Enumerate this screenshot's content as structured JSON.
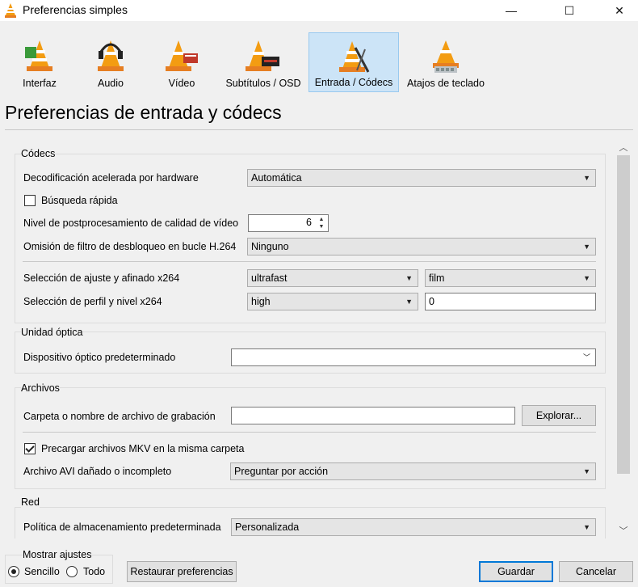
{
  "window": {
    "title": "Preferencias simples",
    "minimize": "—",
    "maximize": "☐",
    "close": "✕"
  },
  "categories": [
    {
      "label": "Interfaz",
      "icon": "cone-interface-icon"
    },
    {
      "label": "Audio",
      "icon": "cone-headphones-icon"
    },
    {
      "label": "Vídeo",
      "icon": "cone-video-icon"
    },
    {
      "label": "Subtítulos / OSD",
      "icon": "cone-subtitles-icon"
    },
    {
      "label": "Entrada / Códecs",
      "icon": "cone-codecs-icon",
      "selected": true
    },
    {
      "label": "Atajos de teclado",
      "icon": "cone-hotkeys-icon"
    }
  ],
  "page_title": "Preferencias de entrada y códecs",
  "codecs": {
    "title": "Códecs",
    "hw_decoding_label": "Decodificación acelerada por hardware",
    "hw_decoding_value": "Automática",
    "fast_seek_label": "Búsqueda rápida",
    "fast_seek_checked": false,
    "postproc_label": "Nivel de postprocesamiento de calidad de vídeo",
    "postproc_value": "6",
    "deblock_label": "Omisión de filtro de desbloqueo en bucle H.264",
    "deblock_value": "Ninguno",
    "preset_label": "Selección de ajuste y afinado x264",
    "preset_value": "ultrafast",
    "tune_value": "film",
    "profile_label": "Selección de perfil y nivel x264",
    "profile_value": "high",
    "level_value": "0"
  },
  "optical": {
    "title": "Unidad óptica",
    "device_label": "Dispositivo óptico predeterminado",
    "device_value": ""
  },
  "files": {
    "title": "Archivos",
    "record_label": "Carpeta o nombre de archivo de grabación",
    "record_value": "",
    "browse_label": "Explorar...",
    "mkv_label": "Precargar archivos MKV en la misma carpeta",
    "mkv_checked": true,
    "avi_label": "Archivo AVI dañado o incompleto",
    "avi_value": "Preguntar por acción"
  },
  "network": {
    "title": "Red",
    "cache_label": "Política de almacenamiento predeterminada",
    "cache_value": "Personalizada"
  },
  "bottom": {
    "show_label": "Mostrar ajustes",
    "simple_label": "Sencillo",
    "all_label": "Todo",
    "reset_label": "Restaurar preferencias",
    "save_label": "Guardar",
    "cancel_label": "Cancelar"
  },
  "colors": {
    "selected_bg": "#cce4f7",
    "cone_orange": "#f39c12",
    "default_button_border": "#0078d7"
  }
}
